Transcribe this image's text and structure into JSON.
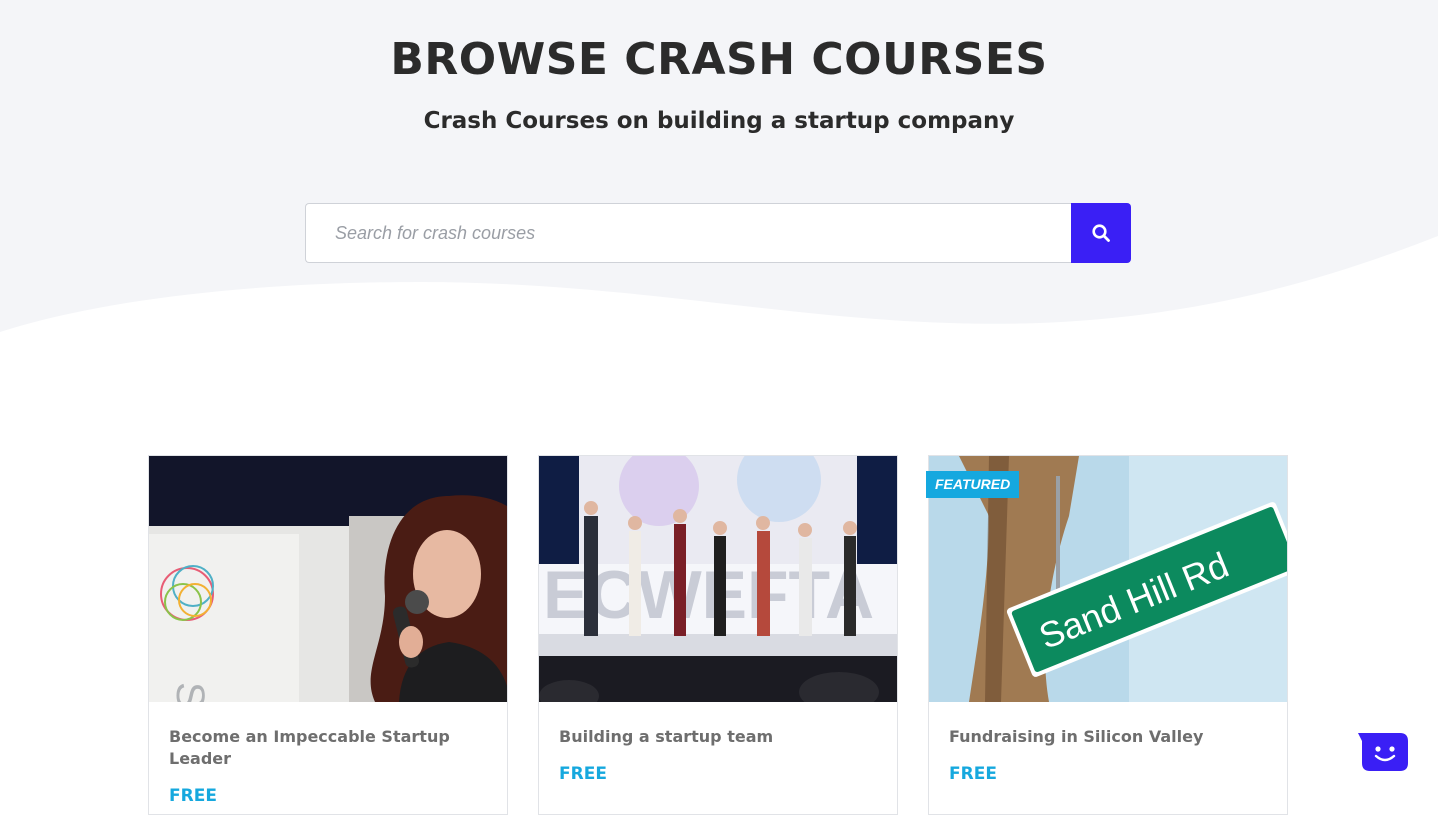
{
  "hero": {
    "title": "BROWSE CRASH COURSES",
    "subtitle": "Crash Courses on building a startup company",
    "background_color": "#f4f5f8"
  },
  "search": {
    "placeholder": "Search for crash courses",
    "value": "",
    "button_icon": "search-icon",
    "button_color": "#3a1ff5"
  },
  "courses": [
    {
      "name": "Become an Impeccable Startup Leader",
      "price": "FREE",
      "featured": false,
      "image": "woman speaking into microphone"
    },
    {
      "name": "Building a startup team",
      "price": "FREE",
      "featured": false,
      "image": "team on stage"
    },
    {
      "name": "Fundraising in Silicon Valley",
      "price": "FREE",
      "featured": true,
      "badge": "FEATURED",
      "image": "Sand Hill Rd street sign",
      "sign_text": "Sand Hill Rd"
    }
  ],
  "colors": {
    "price": "#16a8de",
    "badge": "#15a8df",
    "chat": "#3a1ff5"
  },
  "chat_widget": {
    "icon": "chat-bot-icon"
  }
}
